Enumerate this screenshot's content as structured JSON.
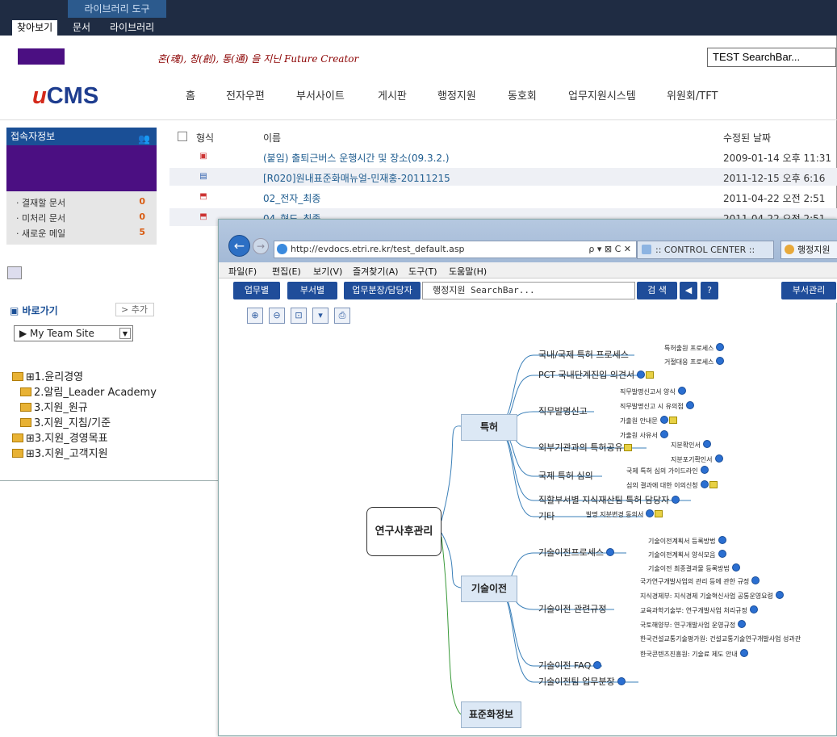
{
  "ribbon": {
    "title": "라이브러리 도구",
    "tabs": [
      "찾아보기",
      "문서",
      "라이브러리"
    ]
  },
  "header": {
    "slogan": "혼(魂), 창(創), 통(通) 을 지닌 Future Creator",
    "search_placeholder": "TEST SearchBar...",
    "logo_u": "u",
    "logo_rest": "CMS",
    "nav": [
      "홈",
      "전자우편",
      "부서사이트",
      "게시판",
      "행정지원",
      "동호회",
      "업무지원시스템",
      "위원회/TFT"
    ]
  },
  "sidebar": {
    "conn_title": "접속자정보",
    "stats": [
      {
        "label": "· 결재할 문서",
        "value": "0"
      },
      {
        "label": "· 미처리 문서",
        "value": "0"
      },
      {
        "label": "· 새로운 메일",
        "value": "5"
      }
    ],
    "goto_label": "바로가기",
    "goto_add": "> 추가",
    "team_select": "▶ My Team Site",
    "tree": [
      "⊞1.윤리경영",
      "2.알림_Leader Academy",
      "3.지원_원규",
      "3.지원_지침/기준",
      "⊞3.지원_경영목표",
      "⊞3.지원_고객지원"
    ]
  },
  "files": {
    "hdr_type": "형식",
    "hdr_name": "이름",
    "hdr_date": "수정된 날짜",
    "rows": [
      {
        "name": "(붙임) 출퇴근버스 운행시간 및 장소(09.3.2.)",
        "date": "2009-01-14 오후 11:31"
      },
      {
        "name": "[R020]원내표준화매뉴얼-민재홍-20111215",
        "date": "2011-12-15 오후 6:16"
      },
      {
        "name": "02_전자_최종",
        "date": "2011-04-22 오전 2:51"
      },
      {
        "name": "04_형도_최종",
        "date": "2011-04-22 오전 2:51"
      }
    ]
  },
  "browser": {
    "url": "http://evdocs.etri.re.kr/test_default.asp",
    "addr_controls": "ρ ▾ ⊠ C ✕",
    "tab1": ":: CONTROL CENTER ::",
    "tab2": "행정지원",
    "menu": [
      "파일(F)",
      "편집(E)",
      "보기(V)",
      "즐겨찾기(A)",
      "도구(T)",
      "도움말(H)"
    ],
    "buttons": [
      "업무별",
      "부서별",
      "업무분장/담당자"
    ],
    "search": "행정지원 SearchBar...",
    "search_btn": "검 색",
    "prev": "◀",
    "help": "?",
    "dept_btn": "부서관리"
  },
  "mindmap": {
    "root": "연구사후관리",
    "branches": [
      {
        "label": "특허"
      },
      {
        "label": "기술이전"
      },
      {
        "label": "표준화정보"
      }
    ],
    "patent": {
      "l1": [
        "국내/국제 특허 프로세스",
        "PCT 국내단계진입 의견서",
        "직무발명신고",
        "외부기관과의 특허공유",
        "국제 특허 심의",
        "직할부서별 지식재산팀 특허 담당자",
        "기타"
      ],
      "l2": [
        "특허출원 프로세스",
        "거절대응 프로세스",
        "직무발명신고서 양식",
        "직무발명신고 시 유의점",
        "가출원 안내문",
        "가출원 사유서",
        "지분확인서",
        "지분포기확인서",
        "국제 특허 심의 가이드라인",
        "심의 결과에 대한 이의신청",
        "발명 지분변경 동의서"
      ]
    },
    "tech": {
      "l1": [
        "기술이전프로세스",
        "기술이전 관련규정",
        "기술이전 FAQ",
        "기술이전팀 업무분장"
      ],
      "l2": [
        "기술이전계획서 등록방법",
        "기술이전계획서 양식모음",
        "기술이전 최종결과물 등록방법",
        "국가연구개발사업의 관리 등에 관한 규정",
        "지식경제부: 지식경제 기술혁신사업 공통운영요령",
        "교육과학기술부: 연구개발사업 처리규정",
        "국토해양부: 연구개발사업 운영규정",
        "한국건설교통기술평가원: 건설교통기술연구개발사업 성과관",
        "한국콘텐츠진흥원: 기술료 제도 안내"
      ]
    }
  },
  "colors": {
    "ribbon": "#1f2c43",
    "accent": "#1f4d9a",
    "purple": "#4b0f82",
    "logo_red": "#d42a1c",
    "logo_blue": "#1e3d8f"
  }
}
